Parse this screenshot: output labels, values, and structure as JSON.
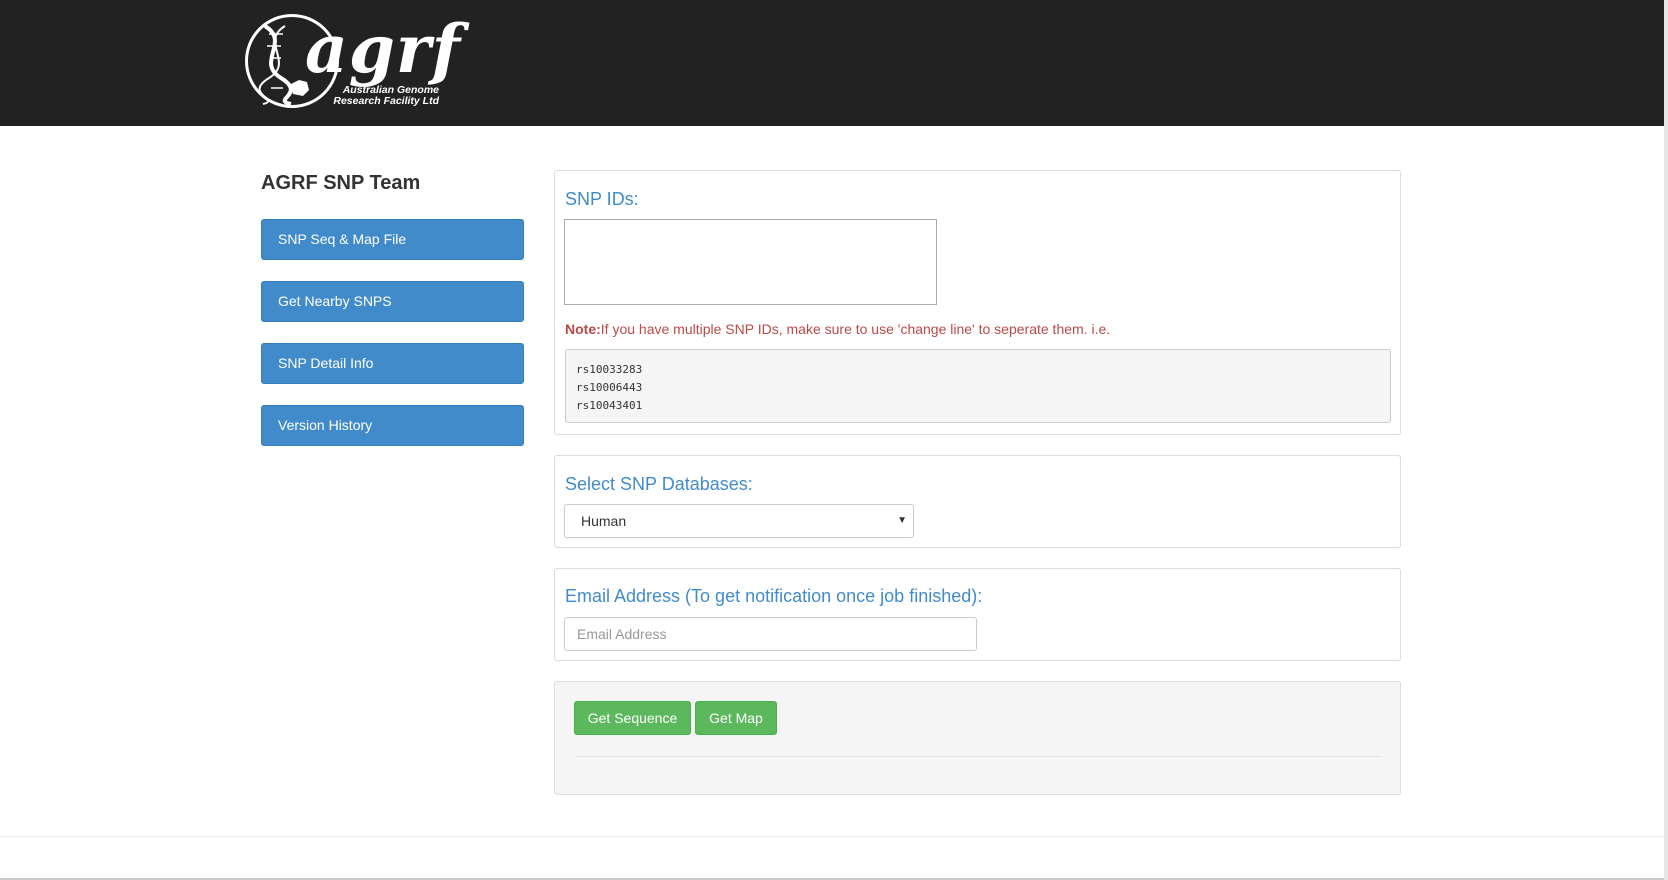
{
  "header": {
    "logo_text": "agrf",
    "logo_subtitle_line1": "Australian Genome",
    "logo_subtitle_line2": "Research Facility Ltd"
  },
  "sidebar": {
    "title": "AGRF SNP Team",
    "items": [
      {
        "label": "SNP Seq & Map File"
      },
      {
        "label": "Get Nearby SNPS"
      },
      {
        "label": "SNP Detail Info"
      },
      {
        "label": "Version History"
      }
    ]
  },
  "snp_ids": {
    "heading": "SNP IDs:",
    "textarea_value": "",
    "note_label": "Note:",
    "note_text": "If you have multiple SNP IDs, make sure to use 'change line' to seperate them. i.e.",
    "examples": [
      "rs10033283",
      "rs10006443",
      "rs10043401"
    ]
  },
  "databases": {
    "heading": "Select SNP Databases:",
    "selected": "Human"
  },
  "email": {
    "heading": "Email Address (To get notification once job finished):",
    "placeholder": "Email Address",
    "value": ""
  },
  "actions": {
    "get_sequence": "Get Sequence",
    "get_map": "Get Map"
  },
  "colors": {
    "header_bg": "#222222",
    "primary": "#428bca",
    "success": "#5cb85c",
    "note": "#b94a48"
  }
}
